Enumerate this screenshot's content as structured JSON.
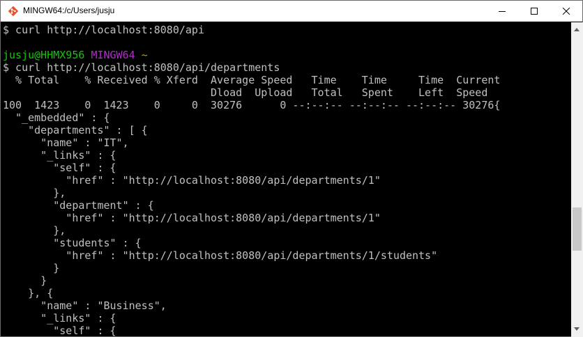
{
  "window": {
    "title": "MINGW64:/c/Users/jusju",
    "icon": "git-bash-icon",
    "accent_color": "#e9502a",
    "controls": [
      "minimize-icon",
      "maximize-icon",
      "close-icon"
    ]
  },
  "terminal": {
    "colors": {
      "text": "#c0c0c0",
      "user": "#16c60c",
      "shell": "#b02cc8",
      "path": "#c1a300"
    },
    "line1": "$ curl http://localhost:8080/api",
    "prompt_user": "jusju@HHMX956",
    "prompt_shell": "MINGW64",
    "prompt_path": "~",
    "line3": "$ curl http://localhost:8080/api/departments",
    "line4": "  % Total    % Received % Xferd  Average Speed   Time    Time     Time  Current",
    "line5": "                                 Dload  Upload   Total   Spent    Left  Speed",
    "line6": "100  1423    0  1423    0     0  30276      0 --:--:-- --:--:-- --:--:-- 30276{",
    "line7": "  \"_embedded\" : {",
    "line8": "    \"departments\" : [ {",
    "line9": "      \"name\" : \"IT\",",
    "line10": "      \"_links\" : {",
    "line11": "        \"self\" : {",
    "line12": "          \"href\" : \"http://localhost:8080/api/departments/1\"",
    "line13": "        },",
    "line14": "        \"department\" : {",
    "line15": "          \"href\" : \"http://localhost:8080/api/departments/1\"",
    "line16": "        },",
    "line17": "        \"students\" : {",
    "line18": "          \"href\" : \"http://localhost:8080/api/departments/1/students\"",
    "line19": "        }",
    "line20": "      }",
    "line21": "    }, {",
    "line22": "      \"name\" : \"Business\",",
    "line23": "      \"_links\" : {",
    "line24": "        \"self\" : {"
  }
}
